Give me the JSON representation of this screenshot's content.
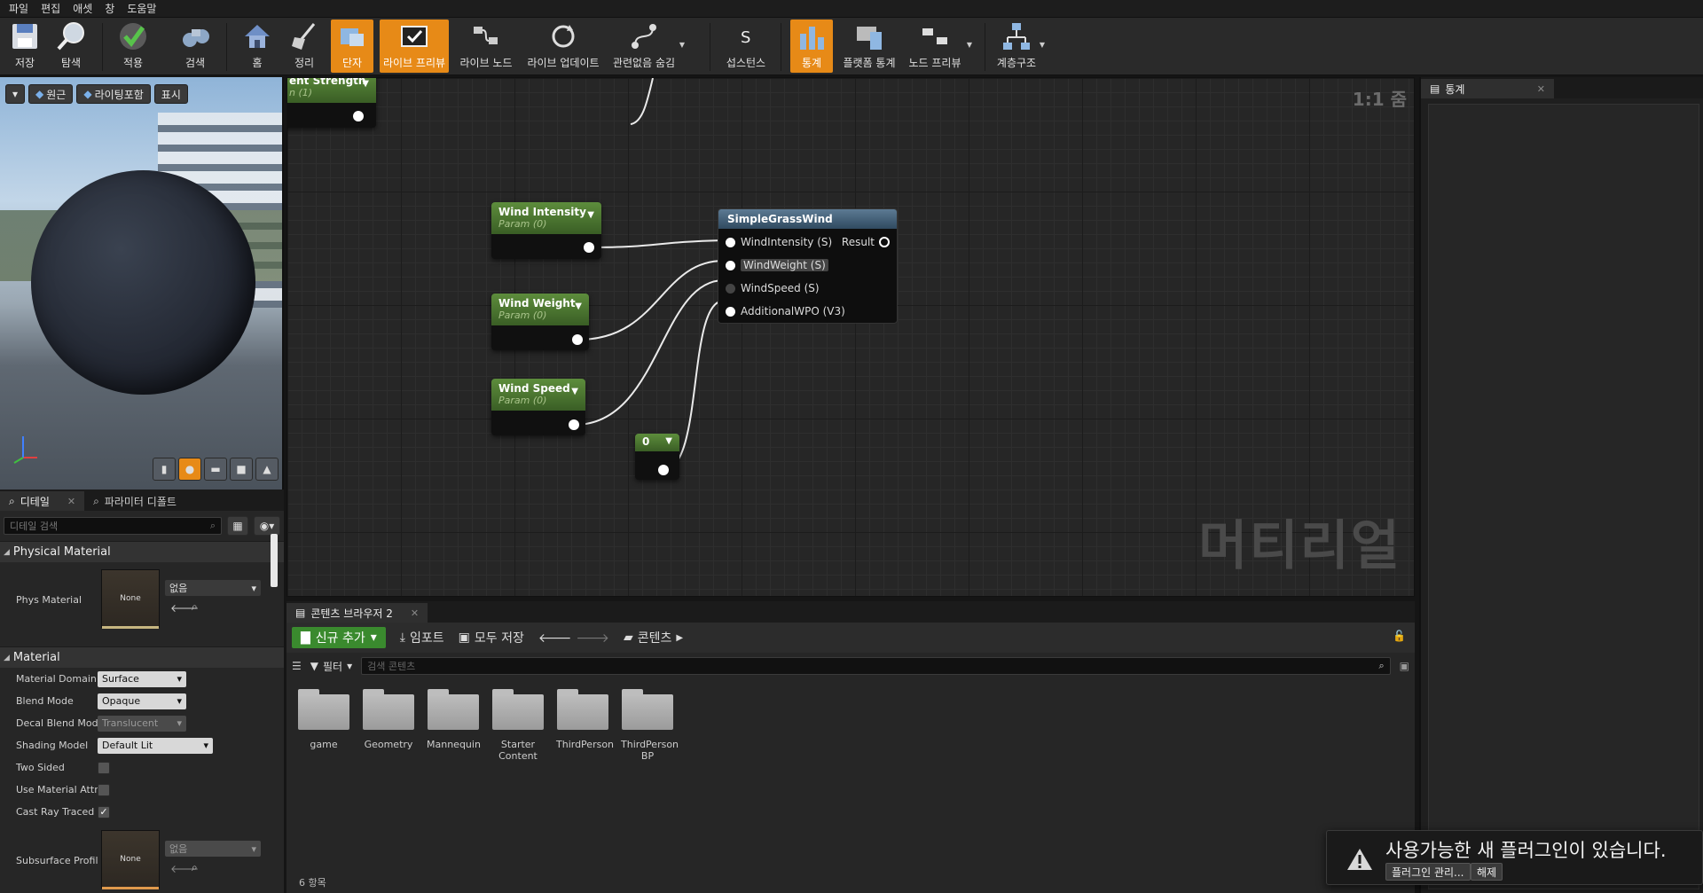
{
  "menu": [
    "파일",
    "편집",
    "애셋",
    "창",
    "도움말"
  ],
  "toolbar": {
    "save": "저장",
    "browse": "탐색",
    "apply": "적용",
    "search": "검색",
    "home": "홈",
    "cleanup": "정리",
    "connectors": "단자",
    "live_preview": "라이브 프리뷰",
    "live_nodes": "라이브 노드",
    "live_update": "라이브 업데이트",
    "hide_unrelated": "관련없음 숨김",
    "instance": "섭스턴스",
    "stats": "통계",
    "platform_stats": "플랫폼 통계",
    "node_preview": "노드 프리뷰",
    "hierarchy": "계층구조"
  },
  "viewport": {
    "perspective": "원근",
    "lit": "라이팅포함",
    "show": "표시"
  },
  "details": {
    "tab_details": "디테일",
    "tab_param_defaults": "파라미터 디폴트",
    "search_placeholder": "디테일 검색",
    "cat_physical": "Physical Material",
    "phys_material": "Phys Material",
    "none_thumb": "None",
    "none_value": "없음",
    "cat_material": "Material",
    "props": [
      {
        "name": "Material Domain",
        "value": "Surface"
      },
      {
        "name": "Blend Mode",
        "value": "Opaque"
      },
      {
        "name": "Decal Blend Mode",
        "value": "Translucent"
      },
      {
        "name": "Shading Model",
        "value": "Default Lit"
      },
      {
        "name": "Two Sided",
        "value": ""
      },
      {
        "name": "Use Material Attri",
        "value": ""
      },
      {
        "name": "Cast Ray Traced S",
        "value": ""
      },
      {
        "name": "Subsurface Profil",
        "value": "없음"
      }
    ]
  },
  "graph": {
    "zoom": "1:1 줌",
    "watermark": "머티리얼",
    "top_node_title": "ent Strength",
    "top_node_sub": "n (1)",
    "nodes": [
      {
        "title": "Wind Intensity",
        "sub": "Param (0)"
      },
      {
        "title": "Wind Weight",
        "sub": "Param (0)"
      },
      {
        "title": "Wind Speed",
        "sub": "Param (0)"
      },
      {
        "title": "0",
        "sub": ""
      }
    ],
    "function": {
      "title": "SimpleGrassWind",
      "inputs": [
        "WindIntensity (S)",
        "WindWeight (S)",
        "WindSpeed (S)",
        "AdditionalWPO (V3)"
      ],
      "output": "Result"
    }
  },
  "content_browser": {
    "tab": "콘텐츠 브라우저 2",
    "add_new": "신규 추가",
    "import": "임포트",
    "save_all": "모두 저장",
    "path": "콘텐츠",
    "filter": "필터",
    "search_placeholder": "검색 콘텐츠",
    "folders": [
      "game",
      "Geometry",
      "Mannequin",
      "Starter Content",
      "ThirdPerson",
      "ThirdPerson BP"
    ],
    "count": "6 항목"
  },
  "stats": {
    "tab": "통계"
  },
  "notification": {
    "message": "사용가능한 새 플러그인이 있습니다.",
    "manage": "플러그인 관리...",
    "dismiss": "해제"
  }
}
